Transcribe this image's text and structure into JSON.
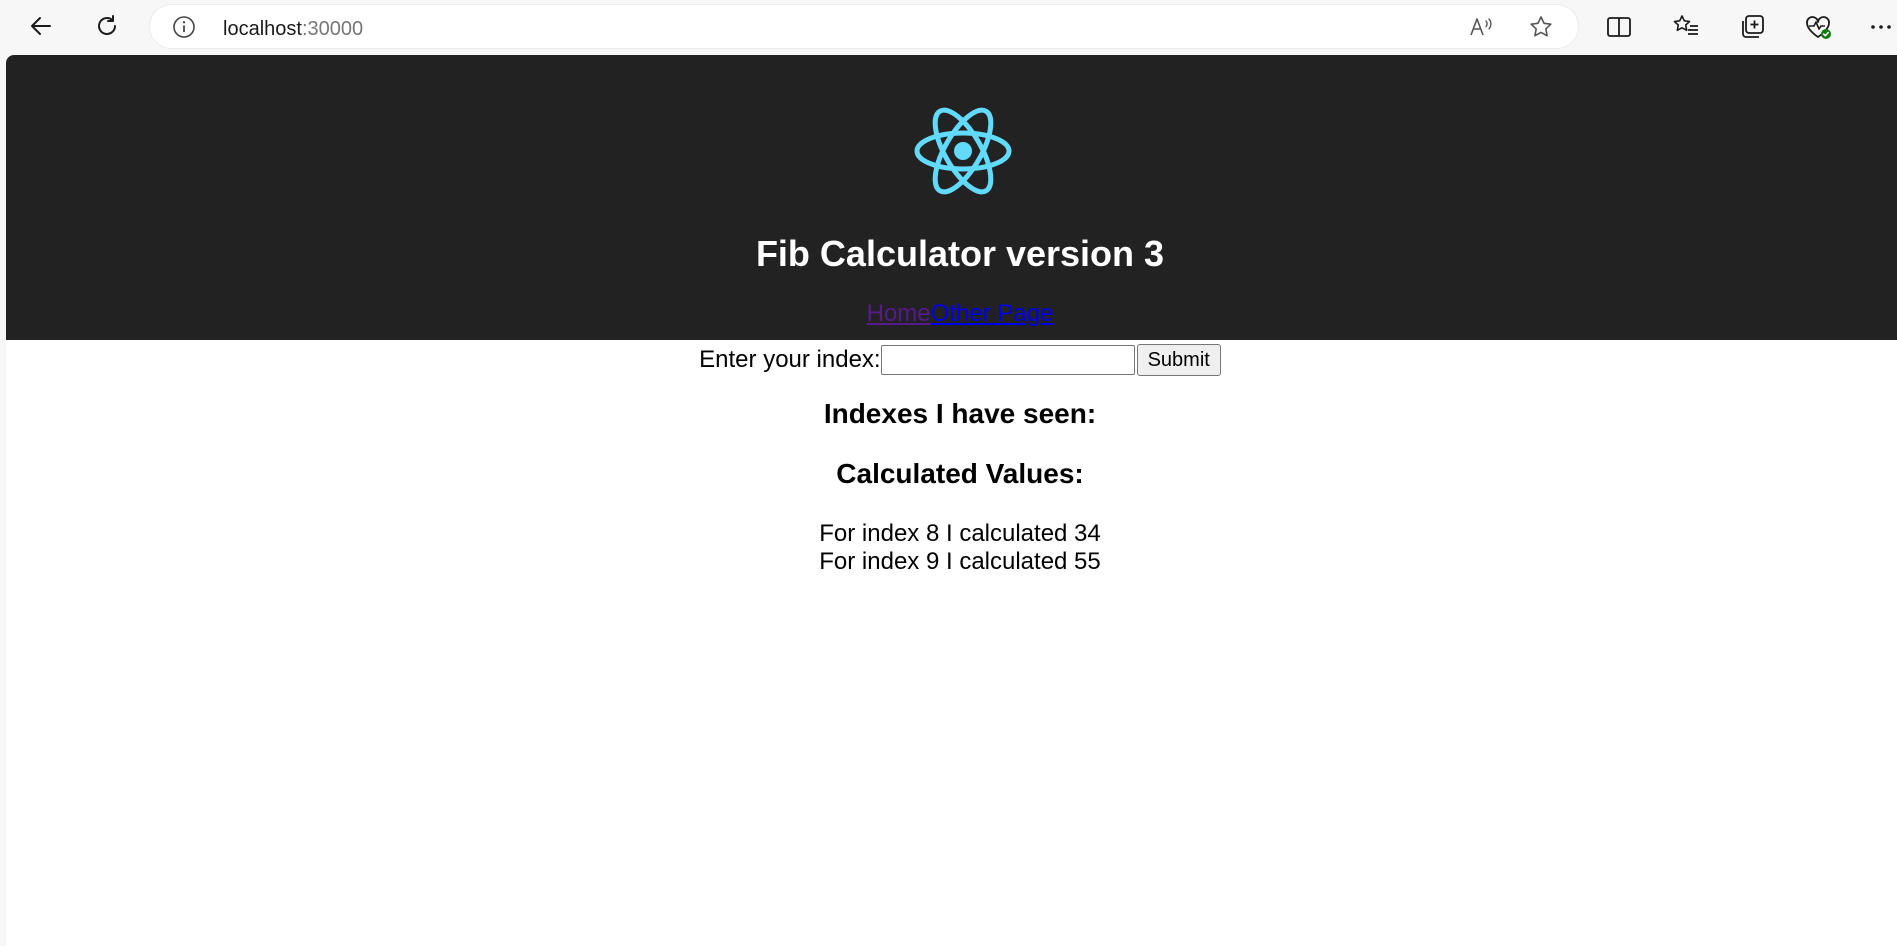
{
  "browser": {
    "url_host": "localhost",
    "url_port": ":30000",
    "icons": {
      "back": "back-arrow-icon",
      "refresh": "refresh-icon",
      "info": "info-icon",
      "read_aloud": "read-aloud-icon",
      "favorite": "star-icon",
      "split_screen": "split-screen-icon",
      "favorites": "favorites-list-icon",
      "collections": "collections-icon",
      "performance": "heart-pulse-icon",
      "more": "more-icon"
    }
  },
  "app": {
    "logo": "react-logo",
    "logo_color": "#61dafb",
    "header_bg": "#222222",
    "title": "Fib Calculator version 3",
    "nav": {
      "home": "Home",
      "other": "Other Page"
    }
  },
  "form": {
    "label": "Enter your index:",
    "input_value": "",
    "submit_label": "Submit"
  },
  "indexes": {
    "heading": "Indexes I have seen:"
  },
  "values": {
    "heading": "Calculated Values:",
    "items": [
      "For index 8 I calculated 34",
      "For index 9 I calculated 55"
    ]
  }
}
